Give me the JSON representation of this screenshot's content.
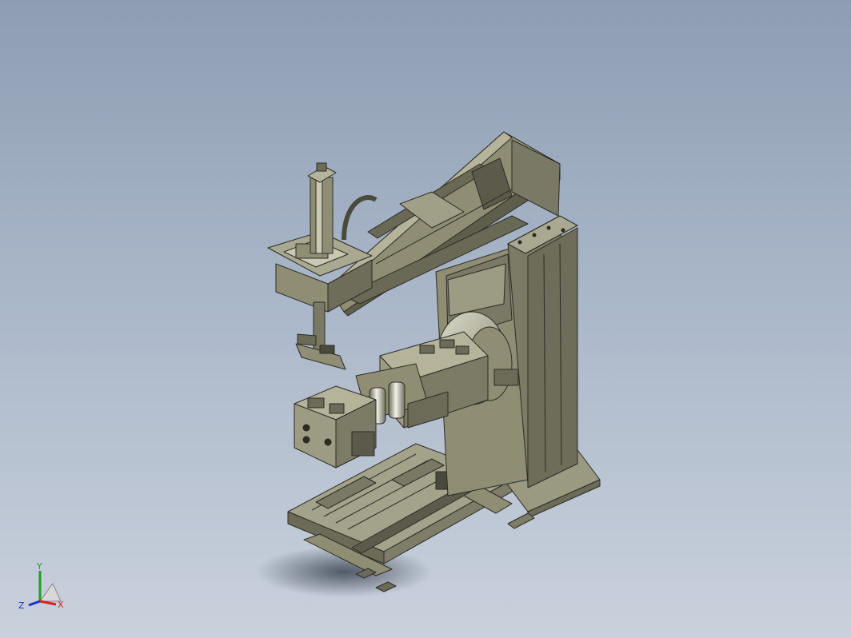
{
  "viewport": {
    "background_top": "#8e9db3",
    "background_bottom": "#c9d1dc",
    "model_colors": {
      "body": "#8f8e74",
      "dark": "#4a4a3c",
      "light": "#b5b49b",
      "edge": "#2b2b24"
    }
  },
  "triad": {
    "x_label": "X",
    "y_label": "Y",
    "z_label": "Z",
    "x_color": "#d62020",
    "y_color": "#1ea01e",
    "z_color": "#2030d0"
  }
}
